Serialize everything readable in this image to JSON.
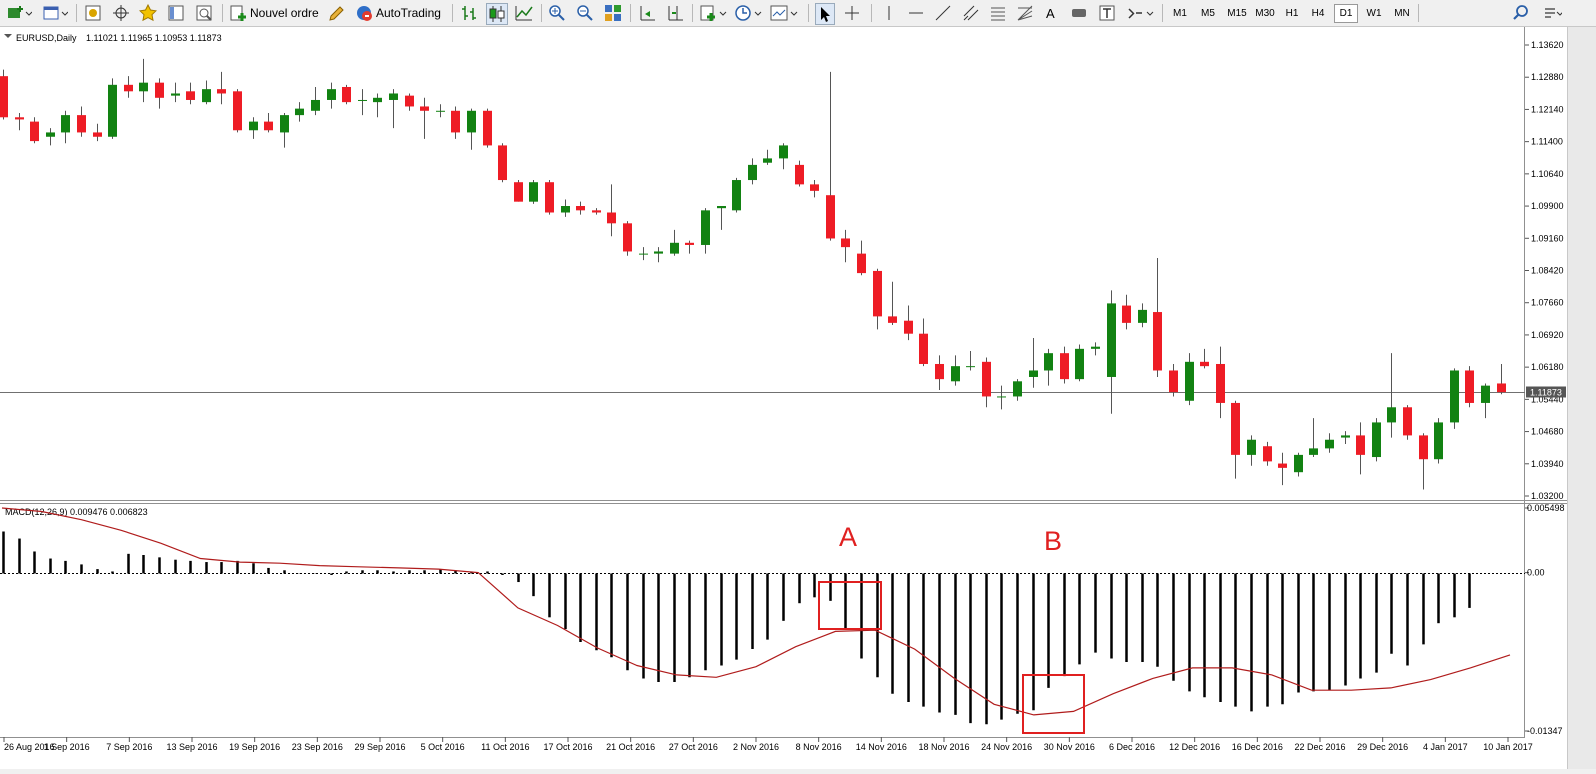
{
  "toolbar": {
    "new_order_label": "Nouvel ordre",
    "autotrading_label": "AutoTrading",
    "timeframes": [
      "M1",
      "M5",
      "M15",
      "M30",
      "H1",
      "H4",
      "D1",
      "W1",
      "MN"
    ],
    "active_timeframe": "D1",
    "text_tool_label": "A"
  },
  "main_chart": {
    "symbol_label": "EURUSD,Daily",
    "ohlc_label": "1.11021 1.11965 1.10953 1.11873",
    "current_price_label": "1.11873",
    "price_ticks": [
      "1.13620",
      "1.12880",
      "1.12140",
      "1.11400",
      "1.10640",
      "1.09900",
      "1.09160",
      "1.08420",
      "1.07660",
      "1.06920",
      "1.06180",
      "1.05440",
      "1.04680",
      "1.03940",
      "1.03200"
    ]
  },
  "macd_panel": {
    "label": "MACD(12,26,9) 0.009476 0.006823",
    "ticks": [
      "0.005498",
      "0.00",
      "-0.01347"
    ],
    "annotation_a": "A",
    "annotation_b": "B"
  },
  "date_labels": [
    "26 Aug 2016",
    "1 Sep 2016",
    "7 Sep 2016",
    "13 Sep 2016",
    "19 Sep 2016",
    "23 Sep 2016",
    "29 Sep 2016",
    "5 Oct 2016",
    "11 Oct 2016",
    "17 Oct 2016",
    "21 Oct 2016",
    "27 Oct 2016",
    "2 Nov 2016",
    "8 Nov 2016",
    "14 Nov 2016",
    "18 Nov 2016",
    "24 Nov 2016",
    "30 Nov 2016",
    "6 Dec 2016",
    "12 Dec 2016",
    "16 Dec 2016",
    "22 Dec 2016",
    "29 Dec 2016",
    "4 Jan 2017",
    "10 Jan 2017"
  ],
  "colors": {
    "bull": "#128212",
    "bear": "#ee1c25",
    "signal_line": "#b01c1c",
    "annotation": "#e02020"
  },
  "chart_data": [
    {
      "type": "candlestick",
      "symbol": "EURUSD",
      "timeframe": "Daily",
      "ylim": [
        1.032,
        1.1362
      ],
      "candles": [
        {
          "o": 1.129,
          "h": 1.1305,
          "l": 1.119,
          "c": 1.1195
        },
        {
          "o": 1.1195,
          "h": 1.1205,
          "l": 1.1165,
          "c": 1.119
        },
        {
          "o": 1.1185,
          "h": 1.1195,
          "l": 1.1135,
          "c": 1.114
        },
        {
          "o": 1.115,
          "h": 1.117,
          "l": 1.113,
          "c": 1.116
        },
        {
          "o": 1.116,
          "h": 1.121,
          "l": 1.1135,
          "c": 1.12
        },
        {
          "o": 1.12,
          "h": 1.122,
          "l": 1.115,
          "c": 1.116
        },
        {
          "o": 1.116,
          "h": 1.118,
          "l": 1.114,
          "c": 1.115
        },
        {
          "o": 1.115,
          "h": 1.1285,
          "l": 1.1145,
          "c": 1.127
        },
        {
          "o": 1.127,
          "h": 1.129,
          "l": 1.124,
          "c": 1.1255
        },
        {
          "o": 1.1255,
          "h": 1.133,
          "l": 1.123,
          "c": 1.1275
        },
        {
          "o": 1.1275,
          "h": 1.1285,
          "l": 1.1215,
          "c": 1.124
        },
        {
          "o": 1.1245,
          "h": 1.1275,
          "l": 1.123,
          "c": 1.125
        },
        {
          "o": 1.1255,
          "h": 1.1275,
          "l": 1.1225,
          "c": 1.1235
        },
        {
          "o": 1.123,
          "h": 1.128,
          "l": 1.1225,
          "c": 1.126
        },
        {
          "o": 1.126,
          "h": 1.13,
          "l": 1.1225,
          "c": 1.125
        },
        {
          "o": 1.1255,
          "h": 1.126,
          "l": 1.116,
          "c": 1.1165
        },
        {
          "o": 1.1165,
          "h": 1.1195,
          "l": 1.1145,
          "c": 1.1185
        },
        {
          "o": 1.1185,
          "h": 1.1205,
          "l": 1.116,
          "c": 1.1165
        },
        {
          "o": 1.116,
          "h": 1.1205,
          "l": 1.1125,
          "c": 1.12
        },
        {
          "o": 1.12,
          "h": 1.123,
          "l": 1.1185,
          "c": 1.1215
        },
        {
          "o": 1.121,
          "h": 1.1265,
          "l": 1.12,
          "c": 1.1235
        },
        {
          "o": 1.1235,
          "h": 1.1275,
          "l": 1.1215,
          "c": 1.126
        },
        {
          "o": 1.1265,
          "h": 1.127,
          "l": 1.1225,
          "c": 1.123
        },
        {
          "o": 1.1235,
          "h": 1.126,
          "l": 1.12,
          "c": 1.1235
        },
        {
          "o": 1.123,
          "h": 1.125,
          "l": 1.1195,
          "c": 1.124
        },
        {
          "o": 1.1235,
          "h": 1.126,
          "l": 1.117,
          "c": 1.125
        },
        {
          "o": 1.1245,
          "h": 1.125,
          "l": 1.121,
          "c": 1.122
        },
        {
          "o": 1.122,
          "h": 1.124,
          "l": 1.1145,
          "c": 1.121
        },
        {
          "o": 1.121,
          "h": 1.1225,
          "l": 1.1195,
          "c": 1.121
        },
        {
          "o": 1.121,
          "h": 1.122,
          "l": 1.1145,
          "c": 1.116
        },
        {
          "o": 1.116,
          "h": 1.1215,
          "l": 1.112,
          "c": 1.121
        },
        {
          "o": 1.121,
          "h": 1.1215,
          "l": 1.1125,
          "c": 1.113
        },
        {
          "o": 1.113,
          "h": 1.1135,
          "l": 1.1045,
          "c": 1.105
        },
        {
          "o": 1.1045,
          "h": 1.105,
          "l": 1.1,
          "c": 1.1
        },
        {
          "o": 1.1,
          "h": 1.105,
          "l": 1.0995,
          "c": 1.1045
        },
        {
          "o": 1.1045,
          "h": 1.105,
          "l": 1.097,
          "c": 1.0975
        },
        {
          "o": 1.0975,
          "h": 1.1005,
          "l": 1.0965,
          "c": 1.099
        },
        {
          "o": 1.099,
          "h": 1.1,
          "l": 1.097,
          "c": 1.098
        },
        {
          "o": 1.098,
          "h": 1.0985,
          "l": 1.097,
          "c": 1.0975
        },
        {
          "o": 1.0975,
          "h": 1.104,
          "l": 1.092,
          "c": 1.095
        },
        {
          "o": 1.095,
          "h": 1.0955,
          "l": 1.0875,
          "c": 1.0885
        },
        {
          "o": 1.088,
          "h": 1.0895,
          "l": 1.0865,
          "c": 1.088
        },
        {
          "o": 1.088,
          "h": 1.0895,
          "l": 1.086,
          "c": 1.0885
        },
        {
          "o": 1.088,
          "h": 1.0935,
          "l": 1.0875,
          "c": 1.0905
        },
        {
          "o": 1.0905,
          "h": 1.091,
          "l": 1.088,
          "c": 1.09
        },
        {
          "o": 1.09,
          "h": 1.0985,
          "l": 1.088,
          "c": 1.098
        },
        {
          "o": 1.0985,
          "h": 1.099,
          "l": 1.0935,
          "c": 1.099
        },
        {
          "o": 1.098,
          "h": 1.1055,
          "l": 1.0975,
          "c": 1.105
        },
        {
          "o": 1.105,
          "h": 1.11,
          "l": 1.104,
          "c": 1.1085
        },
        {
          "o": 1.109,
          "h": 1.112,
          "l": 1.1085,
          "c": 1.11
        },
        {
          "o": 1.11,
          "h": 1.1135,
          "l": 1.1075,
          "c": 1.113
        },
        {
          "o": 1.1085,
          "h": 1.1095,
          "l": 1.1035,
          "c": 1.104
        },
        {
          "o": 1.104,
          "h": 1.105,
          "l": 1.101,
          "c": 1.1025
        },
        {
          "o": 1.1015,
          "h": 1.13,
          "l": 1.091,
          "c": 1.0915
        },
        {
          "o": 1.0915,
          "h": 1.0935,
          "l": 1.086,
          "c": 1.0895
        },
        {
          "o": 1.088,
          "h": 1.091,
          "l": 1.083,
          "c": 1.0835
        },
        {
          "o": 1.084,
          "h": 1.0845,
          "l": 1.0705,
          "c": 1.0735
        },
        {
          "o": 1.0735,
          "h": 1.0815,
          "l": 1.0715,
          "c": 1.072
        },
        {
          "o": 1.0725,
          "h": 1.076,
          "l": 1.068,
          "c": 1.0695
        },
        {
          "o": 1.0695,
          "h": 1.073,
          "l": 1.062,
          "c": 1.0625
        },
        {
          "o": 1.0625,
          "h": 1.0645,
          "l": 1.0565,
          "c": 1.059
        },
        {
          "o": 1.0585,
          "h": 1.0645,
          "l": 1.0575,
          "c": 1.062
        },
        {
          "o": 1.062,
          "h": 1.0655,
          "l": 1.061,
          "c": 1.062
        },
        {
          "o": 1.063,
          "h": 1.064,
          "l": 1.0525,
          "c": 1.055
        },
        {
          "o": 1.055,
          "h": 1.0575,
          "l": 1.052,
          "c": 1.055
        },
        {
          "o": 1.055,
          "h": 1.059,
          "l": 1.054,
          "c": 1.0585
        },
        {
          "o": 1.0595,
          "h": 1.0685,
          "l": 1.057,
          "c": 1.061
        },
        {
          "o": 1.061,
          "h": 1.066,
          "l": 1.0575,
          "c": 1.065
        },
        {
          "o": 1.065,
          "h": 1.0665,
          "l": 1.058,
          "c": 1.059
        },
        {
          "o": 1.059,
          "h": 1.067,
          "l": 1.0585,
          "c": 1.066
        },
        {
          "o": 1.066,
          "h": 1.0675,
          "l": 1.0645,
          "c": 1.0665
        },
        {
          "o": 1.0595,
          "h": 1.0795,
          "l": 1.051,
          "c": 1.0765
        },
        {
          "o": 1.076,
          "h": 1.0785,
          "l": 1.0705,
          "c": 1.072
        },
        {
          "o": 1.072,
          "h": 1.0765,
          "l": 1.071,
          "c": 1.075
        },
        {
          "o": 1.0745,
          "h": 1.087,
          "l": 1.0595,
          "c": 1.061
        },
        {
          "o": 1.061,
          "h": 1.0625,
          "l": 1.055,
          "c": 1.056
        },
        {
          "o": 1.054,
          "h": 1.065,
          "l": 1.053,
          "c": 1.063
        },
        {
          "o": 1.063,
          "h": 1.066,
          "l": 1.0615,
          "c": 1.062
        },
        {
          "o": 1.0625,
          "h": 1.0665,
          "l": 1.05,
          "c": 1.0535
        },
        {
          "o": 1.0535,
          "h": 1.054,
          "l": 1.036,
          "c": 1.0415
        },
        {
          "o": 1.0415,
          "h": 1.046,
          "l": 1.039,
          "c": 1.045
        },
        {
          "o": 1.0435,
          "h": 1.0445,
          "l": 1.039,
          "c": 1.04
        },
        {
          "o": 1.0395,
          "h": 1.042,
          "l": 1.0345,
          "c": 1.0385
        },
        {
          "o": 1.0375,
          "h": 1.042,
          "l": 1.0365,
          "c": 1.0415
        },
        {
          "o": 1.0415,
          "h": 1.05,
          "l": 1.041,
          "c": 1.043
        },
        {
          "o": 1.043,
          "h": 1.0465,
          "l": 1.042,
          "c": 1.045
        },
        {
          "o": 1.0455,
          "h": 1.047,
          "l": 1.044,
          "c": 1.046
        },
        {
          "o": 1.046,
          "h": 1.049,
          "l": 1.037,
          "c": 1.0415
        },
        {
          "o": 1.041,
          "h": 1.05,
          "l": 1.04,
          "c": 1.049
        },
        {
          "o": 1.049,
          "h": 1.065,
          "l": 1.0455,
          "c": 1.0525
        },
        {
          "o": 1.0525,
          "h": 1.053,
          "l": 1.045,
          "c": 1.046
        },
        {
          "o": 1.046,
          "h": 1.0465,
          "l": 1.0335,
          "c": 1.0405
        },
        {
          "o": 1.0405,
          "h": 1.05,
          "l": 1.0395,
          "c": 1.049
        },
        {
          "o": 1.049,
          "h": 1.0615,
          "l": 1.0475,
          "c": 1.061
        },
        {
          "o": 1.061,
          "h": 1.062,
          "l": 1.0525,
          "c": 1.0535
        },
        {
          "o": 1.0535,
          "h": 1.058,
          "l": 1.05,
          "c": 1.0575
        },
        {
          "o": 1.058,
          "h": 1.0625,
          "l": 1.0555,
          "c": 1.056
        }
      ]
    },
    {
      "type": "macd",
      "params": "12,26,9",
      "ylim": [
        -0.01347,
        0.005498
      ],
      "histogram": [
        0.0035,
        0.0029,
        0.0018,
        0.0012,
        0.001,
        0.0007,
        0.0003,
        0.0001,
        0.0016,
        0.0015,
        0.0013,
        0.0011,
        0.001,
        0.0009,
        0.0009,
        0.001,
        0.0008,
        0.0004,
        0.0002,
        -0.0001,
        -0.0001,
        -0.0002,
        0.0001,
        0.0002,
        0.0002,
        0.0001,
        0.0002,
        0.0002,
        0.0003,
        0.0002,
        0.0001,
        0.0001,
        -0.0002,
        -0.0008,
        -0.002,
        -0.0038,
        -0.0048,
        -0.0059,
        -0.0066,
        -0.0072,
        -0.0083,
        -0.009,
        -0.0093,
        -0.0093,
        -0.0089,
        -0.0083,
        -0.0079,
        -0.0074,
        -0.0065,
        -0.0057,
        -0.0041,
        -0.0026,
        -0.0021,
        -0.0024,
        -0.0048,
        -0.0073,
        -0.0089,
        -0.0103,
        -0.011,
        -0.0114,
        -0.0119,
        -0.0121,
        -0.0128,
        -0.0129,
        -0.0125,
        -0.012,
        -0.0117,
        -0.0098,
        -0.0088,
        -0.0078,
        -0.0068,
        -0.0073,
        -0.0076,
        -0.0076,
        -0.008,
        -0.0092,
        -0.0101,
        -0.0106,
        -0.011,
        -0.0114,
        -0.0118,
        -0.0114,
        -0.0112,
        -0.0102,
        -0.0101,
        -0.01,
        -0.0096,
        -0.009,
        -0.0085,
        -0.0069,
        -0.0079,
        -0.0061,
        -0.0043,
        -0.0038,
        -0.003
      ],
      "signal": [
        0.0055,
        0.0052,
        0.0045,
        0.0036,
        0.0025,
        0.0012,
        0.0009,
        0.0008,
        0.0006,
        0.0005,
        0.0004,
        0.0003,
        0.0,
        -0.003,
        -0.0045,
        -0.0064,
        -0.0079,
        -0.0087,
        -0.0089,
        -0.008,
        -0.0063,
        -0.005,
        -0.0049,
        -0.0065,
        -0.009,
        -0.0112,
        -0.0121,
        -0.0118,
        -0.0103,
        -0.009,
        -0.0081,
        -0.0081,
        -0.0087,
        -0.01,
        -0.01,
        -0.0098,
        -0.0091,
        -0.0081,
        -0.007
      ],
      "annotations": [
        "A",
        "B"
      ]
    }
  ]
}
